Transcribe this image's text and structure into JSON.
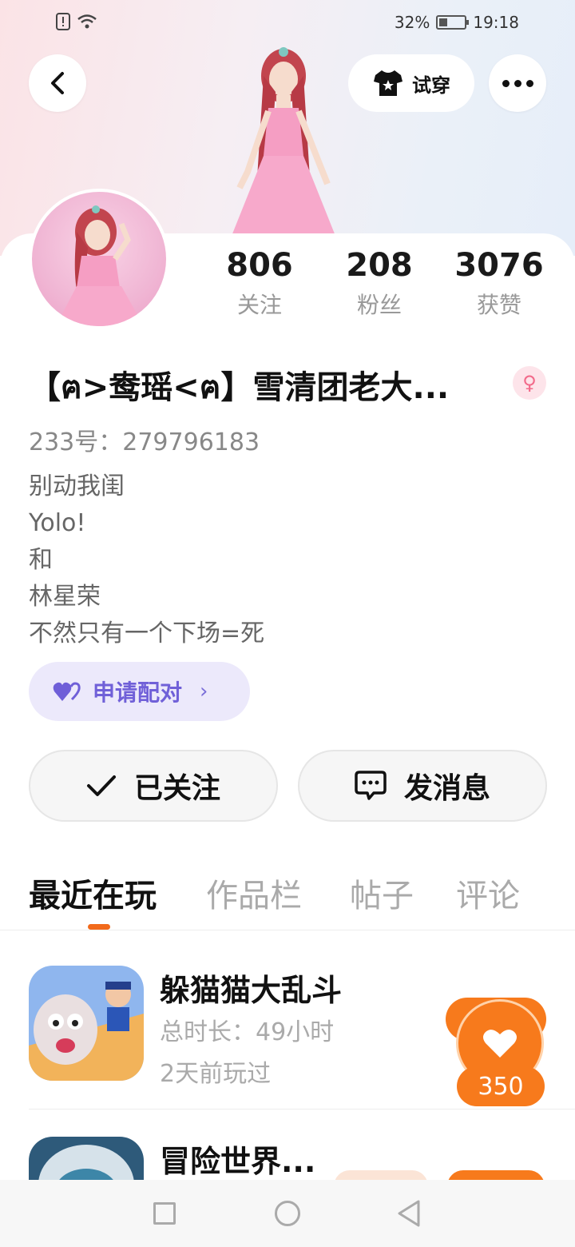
{
  "status_bar": {
    "battery": "32%",
    "time": "19:18"
  },
  "header": {
    "try_on_label": "试穿"
  },
  "stats": [
    {
      "value": "806",
      "label": "关注"
    },
    {
      "value": "208",
      "label": "粉丝"
    },
    {
      "value": "3076",
      "label": "获赞"
    }
  ],
  "profile": {
    "username": "【ฅ>鸯瑶<ฅ】雪清团老大...",
    "uid": "233号：279796183",
    "bio_lines": [
      "别动我闺",
      "Yolo!",
      "和",
      "林星荣",
      "不然只有一个下场=死"
    ],
    "pair_label": "申请配对"
  },
  "actions": {
    "follow_label": "已关注",
    "message_label": "发消息"
  },
  "tabs": [
    "最近在玩",
    "作品栏",
    "帖子",
    "评论"
  ],
  "games": [
    {
      "title": "躲猫猫大乱斗",
      "duration": "总时长：49小时",
      "last_played": "2天前玩过",
      "likes": "350"
    },
    {
      "title": "冒险世界..."
    }
  ],
  "colors": {
    "accent_orange": "#f77a1c",
    "pair_purple": "#7060d8"
  }
}
